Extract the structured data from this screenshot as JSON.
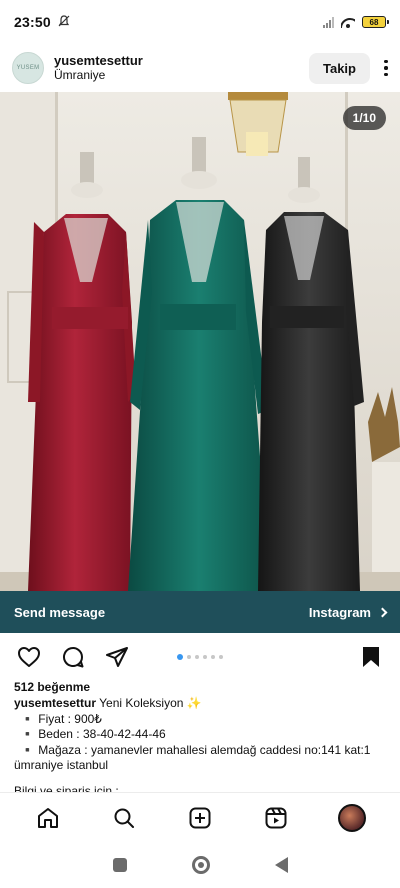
{
  "status_bar": {
    "time": "23:50",
    "mute_icon": "bell-off-icon",
    "battery": "68"
  },
  "post": {
    "avatar_text": "YUSEM",
    "username": "yusemtesettur",
    "location": "Ümraniye",
    "follow_label": "Takip",
    "image_counter": "1/10",
    "dress_colors": [
      "#9c1b2a",
      "#146a5e",
      "#2b2b2b"
    ]
  },
  "cta": {
    "left_label": "Send message",
    "right_label": "Instagram"
  },
  "actions": {
    "carousel_total": 6,
    "carousel_active": 0
  },
  "caption": {
    "likes": "512 beğenme",
    "username": "yusemtesettur",
    "title": "Yeni Koleksiyon ✨",
    "price": "▪️ Fiyat : 900₺",
    "size": "▪️ Beden : 38-40-42-44-46",
    "store_1": "▪️ Mağaza : yamanevler mahallesi alemdağ caddesi no:141 kat:1",
    "store_2": "ümraniye istanbul",
    "info": "Bilgi ve sipariş için ;"
  }
}
